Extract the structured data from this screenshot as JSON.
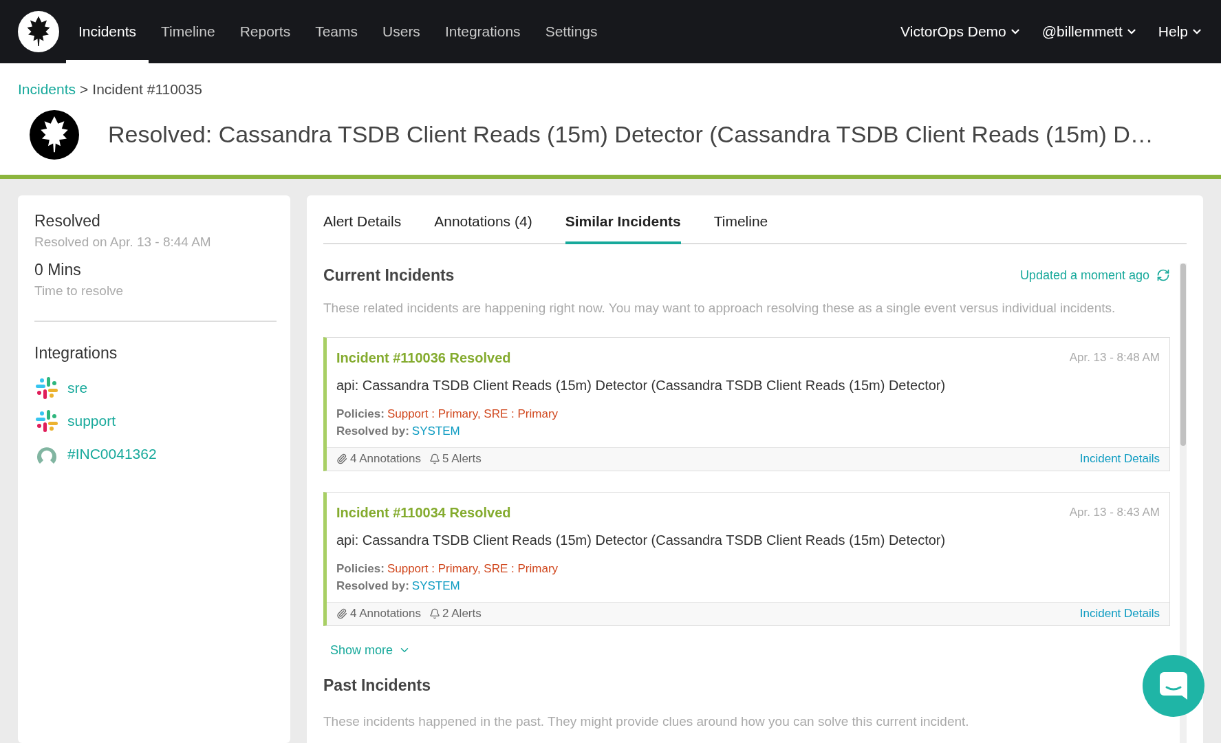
{
  "nav": {
    "items": [
      {
        "label": "Incidents",
        "selected": true
      },
      {
        "label": "Timeline",
        "selected": false
      },
      {
        "label": "Reports",
        "selected": false
      },
      {
        "label": "Teams",
        "selected": false
      },
      {
        "label": "Users",
        "selected": false
      },
      {
        "label": "Integrations",
        "selected": false
      },
      {
        "label": "Settings",
        "selected": false
      }
    ],
    "menus": [
      "VictorOps Demo",
      "@billemmett",
      "Help"
    ]
  },
  "breadcrumb": {
    "link": "Incidents",
    "separator": ">",
    "current": "Incident #110035"
  },
  "title": "Resolved: Cassandra TSDB Client Reads (15m) Detector (Cassandra TSDB Client Reads (15m) D…",
  "summary": {
    "status": "Resolved",
    "status_detail": "Resolved on Apr. 13 - 8:44 AM",
    "duration": "0 Mins",
    "duration_label": "Time to resolve"
  },
  "integrations": {
    "heading": "Integrations",
    "items": [
      {
        "kind": "slack",
        "label": "sre"
      },
      {
        "kind": "slack",
        "label": "support"
      },
      {
        "kind": "ticket",
        "label": "#INC0041362"
      }
    ]
  },
  "tabs": [
    {
      "label": "Alert Details",
      "selected": false
    },
    {
      "label": "Annotations (4)",
      "selected": false
    },
    {
      "label": "Similar Incidents",
      "selected": true
    },
    {
      "label": "Timeline",
      "selected": false
    }
  ],
  "current": {
    "heading": "Current Incidents",
    "updated": "Updated a moment ago",
    "description": "These related incidents are happening right now. You may want to approach resolving these as a single event versus individual incidents.",
    "incidents": [
      {
        "title": "Incident #110036 Resolved",
        "time": "Apr. 13 - 8:48 AM",
        "summary": "api: Cassandra TSDB Client Reads (15m) Detector (Cassandra TSDB Client Reads (15m) Detector)",
        "policies_label": "Policies:",
        "policies": "Support : Primary, SRE : Primary",
        "resolved_label": "Resolved by:",
        "resolved_by": "SYSTEM",
        "annotations": "4 Annotations",
        "alerts": "5 Alerts",
        "link": "Incident Details"
      },
      {
        "title": "Incident #110034 Resolved",
        "time": "Apr. 13 - 8:43 AM",
        "summary": "api: Cassandra TSDB Client Reads (15m) Detector (Cassandra TSDB Client Reads (15m) Detector)",
        "policies_label": "Policies:",
        "policies": "Support : Primary, SRE : Primary",
        "resolved_label": "Resolved by:",
        "resolved_by": "SYSTEM",
        "annotations": "4 Annotations",
        "alerts": "2 Alerts",
        "link": "Incident Details"
      }
    ],
    "show_more": "Show more"
  },
  "past": {
    "heading": "Past Incidents",
    "description": "These incidents happened in the past. They might provide clues around how you can solve this current incident."
  }
}
